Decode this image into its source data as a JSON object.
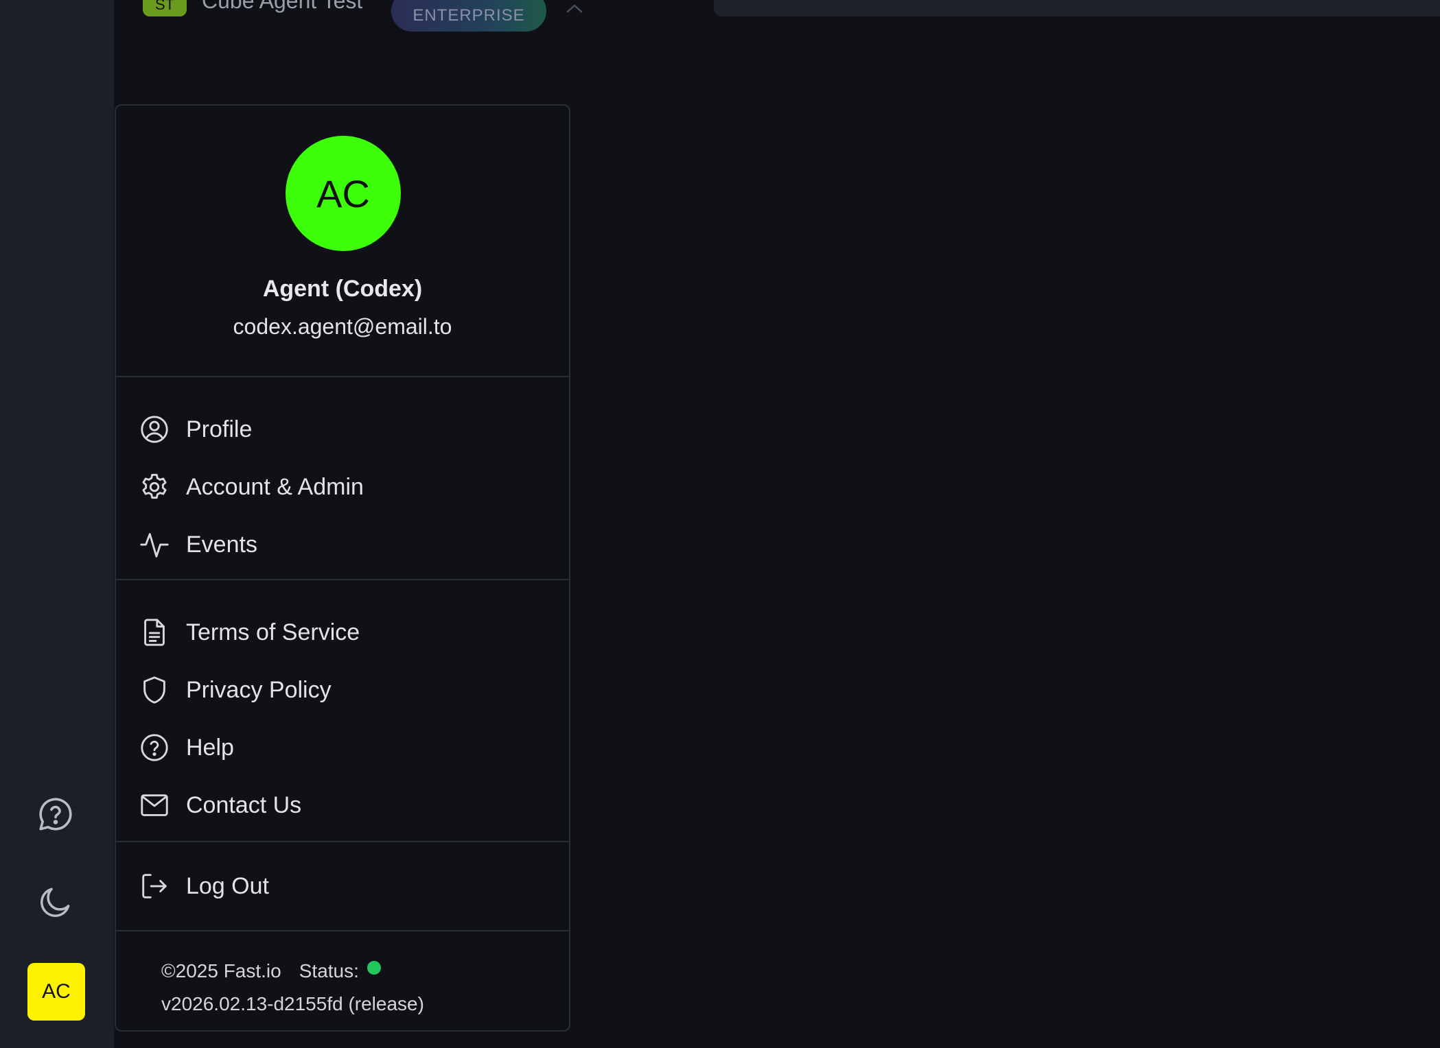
{
  "workspace": {
    "badge": "ST",
    "name": "Cube Agent Test",
    "plan": "ENTERPRISE"
  },
  "rail": {
    "avatar_initials": "AC"
  },
  "user_menu": {
    "avatar_initials": "AC",
    "avatar_color": "#3dff0a",
    "name": "Agent (Codex)",
    "email": "codex.agent@email.to",
    "sections": [
      [
        {
          "label": "Profile",
          "icon": "user-circle-icon"
        },
        {
          "label": "Account & Admin",
          "icon": "gear-icon"
        },
        {
          "label": "Events",
          "icon": "activity-icon"
        }
      ],
      [
        {
          "label": "Terms of Service",
          "icon": "document-icon"
        },
        {
          "label": "Privacy Policy",
          "icon": "shield-icon"
        },
        {
          "label": "Help",
          "icon": "help-circle-icon"
        },
        {
          "label": "Contact Us",
          "icon": "mail-icon"
        }
      ],
      [
        {
          "label": "Log Out",
          "icon": "logout-icon"
        }
      ]
    ],
    "footer": {
      "copyright": "©2025 Fast.io",
      "status_label": "Status:",
      "status_color": "#22c55e",
      "version": "v2026.02.13-d2155fd (release)"
    }
  }
}
